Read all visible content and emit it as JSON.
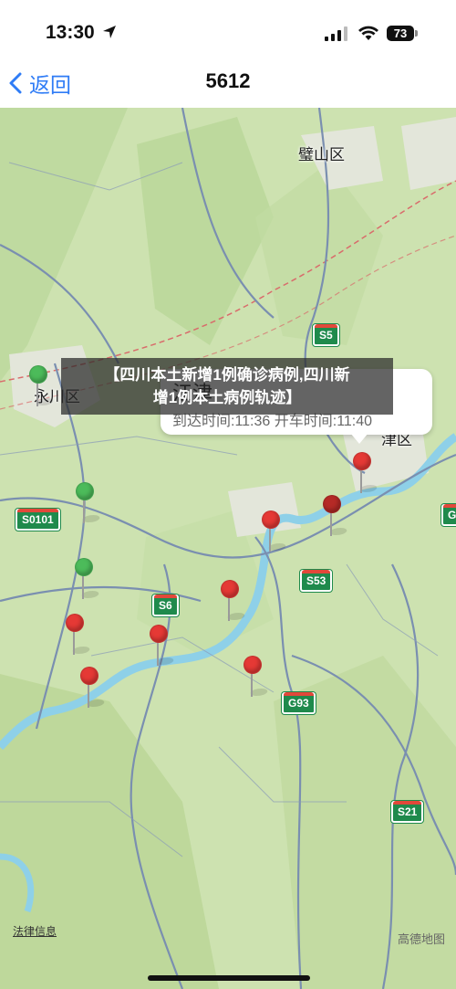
{
  "status_bar": {
    "time": "13:30",
    "battery": "73",
    "icons": [
      "location-arrow-icon",
      "signal-icon",
      "wifi-icon",
      "battery-icon"
    ]
  },
  "nav": {
    "back_label": "返回",
    "title": "5612"
  },
  "map": {
    "place_labels": [
      "璧山区",
      "永川区",
      "津区"
    ],
    "road_shields": [
      "S5",
      "S0101",
      "S53",
      "S6",
      "G93",
      "S21",
      "G"
    ],
    "callout": {
      "title": "江津",
      "subtitle": "到达时间:11:36 开车时间:11:40"
    },
    "legal": "法律信息",
    "logo": "高德地图",
    "pin_colors": {
      "green": "#4cbb5a",
      "red": "#e53935",
      "dark_red": "#b52a26"
    }
  },
  "banner": {
    "line1": "【四川本土新增1例确诊病例,四川新",
    "line2": "增1例本土病例轨迹】"
  }
}
